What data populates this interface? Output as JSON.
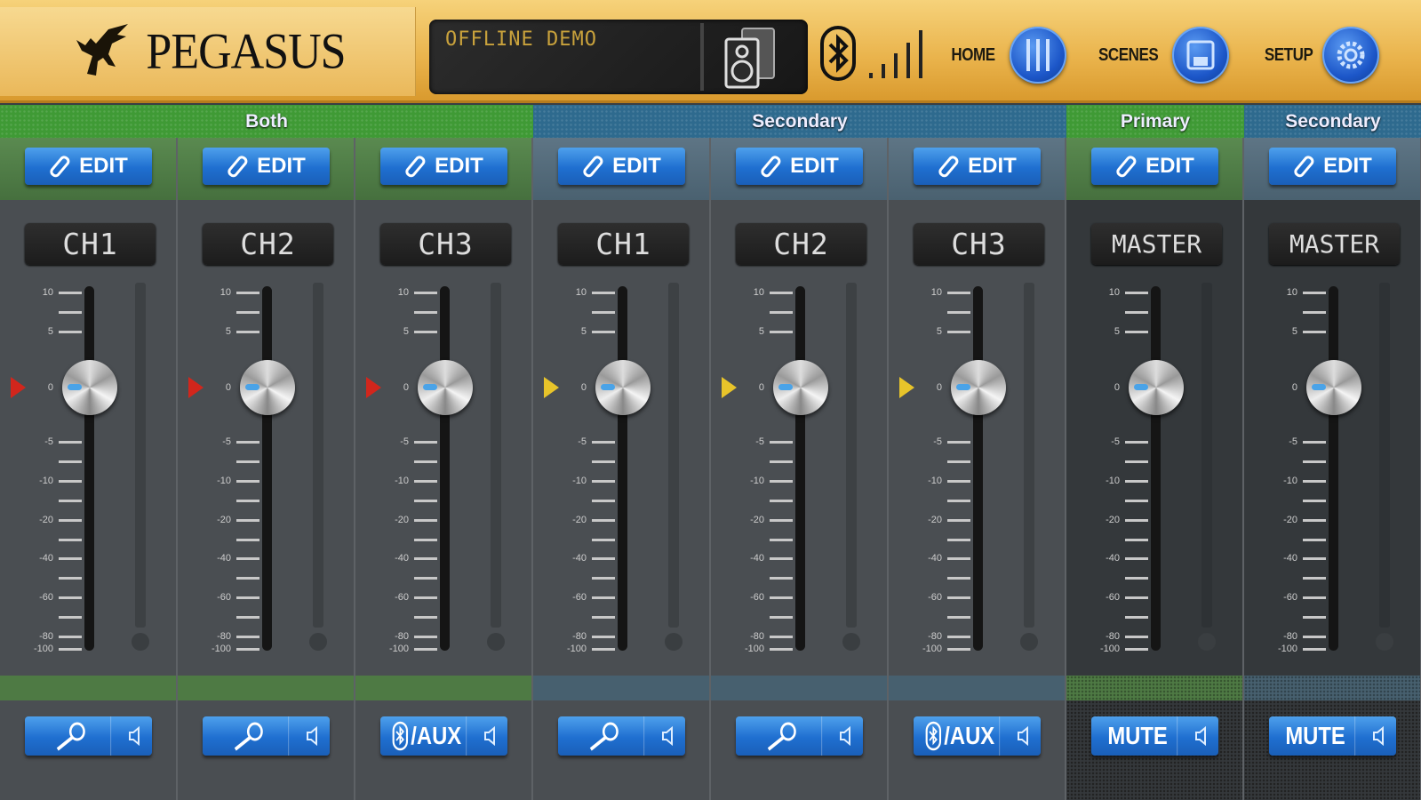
{
  "header": {
    "brand": "PEGASUS",
    "display_text": "OFFLINE DEMO",
    "nav": [
      {
        "label": "HOME",
        "icon": "faders-icon"
      },
      {
        "label": "SCENES",
        "icon": "save-icon"
      },
      {
        "label": "SETUP",
        "icon": "gear-icon"
      }
    ]
  },
  "colors": {
    "green": "#3f9a35",
    "blue": "#2e6a8e",
    "edit_green": "#4d7c45",
    "edit_blue": "#52697a",
    "band_green": "#4e7a44",
    "band_blue": "#47606f",
    "marker_red": "#d2261c",
    "marker_yellow": "#e8c42a"
  },
  "groups": [
    {
      "label": "Both",
      "color": "green",
      "span": 3
    },
    {
      "label": "Secondary",
      "color": "blue",
      "span": 3
    },
    {
      "label": "Primary",
      "color": "green",
      "span": 1
    },
    {
      "label": "Secondary",
      "color": "blue",
      "span": 1
    }
  ],
  "edit_label": "EDIT",
  "scale": [
    {
      "db": 10,
      "label": "10"
    },
    {
      "db": 7.5,
      "label": ""
    },
    {
      "db": 5,
      "label": "5"
    },
    {
      "db": -5,
      "label": "-5"
    },
    {
      "db": -7.5,
      "label": ""
    },
    {
      "db": -10,
      "label": "-10"
    },
    {
      "db": -15,
      "label": ""
    },
    {
      "db": -20,
      "label": "-20"
    },
    {
      "db": -30,
      "label": ""
    },
    {
      "db": -40,
      "label": "-40"
    },
    {
      "db": -50,
      "label": ""
    },
    {
      "db": -60,
      "label": "-60"
    },
    {
      "db": -70,
      "label": ""
    },
    {
      "db": -80,
      "label": "-80"
    },
    {
      "db": -100,
      "label": "-100"
    }
  ],
  "zero_label": "0",
  "strips": [
    {
      "name": "CH1",
      "group": "green",
      "fader_db": 0,
      "marker": "marker_red",
      "button": "mic",
      "button_label": ""
    },
    {
      "name": "CH2",
      "group": "green",
      "fader_db": 0,
      "marker": "marker_red",
      "button": "mic",
      "button_label": ""
    },
    {
      "name": "CH3",
      "group": "green",
      "fader_db": 0,
      "marker": "marker_red",
      "button": "bt-aux",
      "button_label": "/AUX"
    },
    {
      "name": "CH1",
      "group": "blue",
      "fader_db": 0,
      "marker": "marker_yellow",
      "button": "mic",
      "button_label": ""
    },
    {
      "name": "CH2",
      "group": "blue",
      "fader_db": 0,
      "marker": "marker_yellow",
      "button": "mic",
      "button_label": ""
    },
    {
      "name": "CH3",
      "group": "blue",
      "fader_db": 0,
      "marker": "marker_yellow",
      "button": "bt-aux",
      "button_label": "/AUX"
    },
    {
      "name": "MASTER",
      "group": "green",
      "fader_db": 0,
      "marker": null,
      "button": "mute",
      "button_label": "MUTE",
      "master": true
    },
    {
      "name": "MASTER",
      "group": "blue",
      "fader_db": 0,
      "marker": null,
      "button": "mute",
      "button_label": "MUTE",
      "master": true
    }
  ]
}
